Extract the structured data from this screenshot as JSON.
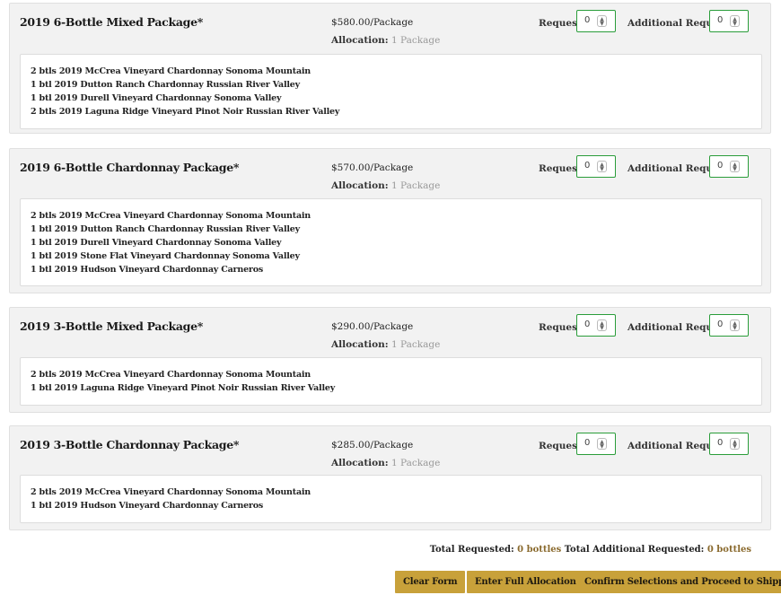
{
  "request_label": "Request:",
  "additional_request_label": "Additional Request:",
  "allocation_label": "Allocation:",
  "packages": [
    {
      "title": "2019 6-Bottle Mixed Package*",
      "price": "$580.00/Package",
      "allocation": "1 Package",
      "request_value": "0",
      "additional_request_value": "0",
      "items": [
        "2 btls 2019 McCrea Vineyard Chardonnay Sonoma Mountain",
        "1 btl 2019 Dutton Ranch Chardonnay Russian River Valley",
        "1 btl 2019 Durell Vineyard Chardonnay Sonoma Valley",
        "2 btls 2019 Laguna Ridge Vineyard Pinot Noir Russian River Valley"
      ]
    },
    {
      "title": "2019 6-Bottle Chardonnay Package*",
      "price": "$570.00/Package",
      "allocation": "1 Package",
      "request_value": "0",
      "additional_request_value": "0",
      "items": [
        "2 btls 2019 McCrea Vineyard Chardonnay Sonoma Mountain",
        "1 btl 2019 Dutton Ranch Chardonnay Russian River Valley",
        "1 btl 2019 Durell Vineyard Chardonnay Sonoma Valley",
        "1 btl 2019 Stone Flat Vineyard Chardonnay Sonoma Valley",
        "1 btl 2019 Hudson Vineyard Chardonnay Carneros"
      ]
    },
    {
      "title": "2019 3-Bottle Mixed Package*",
      "price": "$290.00/Package",
      "allocation": "1 Package",
      "request_value": "0",
      "additional_request_value": "0",
      "items": [
        "2 btls 2019 McCrea Vineyard Chardonnay Sonoma Mountain",
        "1 btl 2019 Laguna Ridge Vineyard Pinot Noir Russian River Valley"
      ]
    },
    {
      "title": "2019 3-Bottle Chardonnay Package*",
      "price": "$285.00/Package",
      "allocation": "1 Package",
      "request_value": "0",
      "additional_request_value": "0",
      "items": [
        "2 btls 2019 McCrea Vineyard Chardonnay Sonoma Mountain",
        "1 btl 2019 Hudson Vineyard Chardonnay Carneros"
      ]
    }
  ],
  "totals": {
    "requested_label": "Total Requested:",
    "requested_value": "0 bottles",
    "additional_label": "Total Additional Requested:",
    "additional_value": "0 bottles"
  },
  "buttons": {
    "clear": "Clear Form",
    "full_allocation": "Enter Full Allocation",
    "confirm": "Confirm Selections and Proceed to Shipping"
  },
  "icons": {
    "stepper": "up-down-spinner-icon"
  },
  "colors": {
    "accent_gold": "#c8a13a",
    "input_border_green": "#2a9d3a"
  }
}
